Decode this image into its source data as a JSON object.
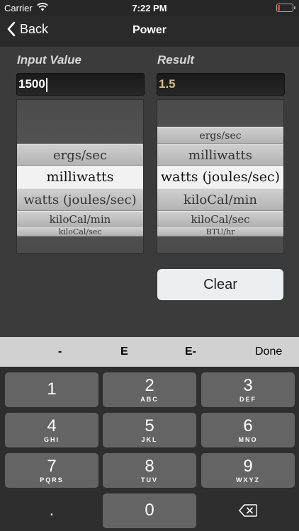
{
  "status_bar": {
    "carrier": "Carrier",
    "time": "7:22 PM",
    "battery_level": 0.15,
    "battery_color": "#e0403a"
  },
  "nav": {
    "back_label": "Back",
    "title": "Power"
  },
  "input": {
    "label": "Input Value",
    "value": "1500"
  },
  "result": {
    "label": "Result",
    "value": "1.5"
  },
  "input_picker": {
    "items": [
      "ergs/sec",
      "milliwatts",
      "watts (joules/sec)",
      "kiloCal/min",
      "kiloCal/sec"
    ],
    "selected": "milliwatts"
  },
  "result_picker": {
    "items": [
      "ergs/sec",
      "milliwatts",
      "watts (joules/sec)",
      "kiloCal/min",
      "kiloCal/sec",
      "BTU/hr"
    ],
    "selected": "watts (joules/sec)"
  },
  "clear_label": "Clear",
  "accessory_bar": {
    "keys": [
      "-",
      "E",
      "E-",
      "Done"
    ]
  },
  "keypad": {
    "keys": [
      {
        "num": "1",
        "letters": ""
      },
      {
        "num": "2",
        "letters": "ABC"
      },
      {
        "num": "3",
        "letters": "DEF"
      },
      {
        "num": "4",
        "letters": "GHI"
      },
      {
        "num": "5",
        "letters": "JKL"
      },
      {
        "num": "6",
        "letters": "MNO"
      },
      {
        "num": "7",
        "letters": "PQRS"
      },
      {
        "num": "8",
        "letters": "TUV"
      },
      {
        "num": "9",
        "letters": "WXYZ"
      },
      {
        "num": ".",
        "letters": ""
      },
      {
        "num": "0",
        "letters": ""
      }
    ],
    "delete_icon": "backspace-icon"
  }
}
